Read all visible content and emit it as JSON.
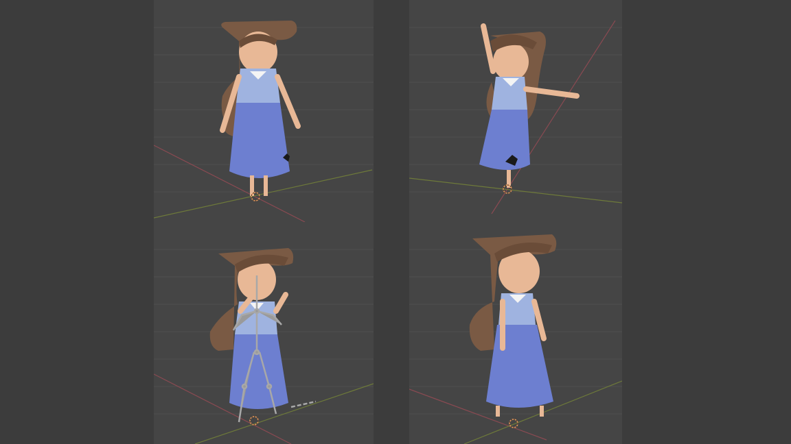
{
  "viewports": [
    {
      "id": "front-rest",
      "pose": "a-pose",
      "armature_visible": false
    },
    {
      "id": "dance-pose",
      "pose": "raised-arm",
      "armature_visible": false
    },
    {
      "id": "armature-view",
      "pose": "hands-up",
      "armature_visible": true
    },
    {
      "id": "three-quarter",
      "pose": "hands-on-hips",
      "armature_visible": false
    }
  ],
  "colors": {
    "background": "#3c3c3c",
    "viewport_bg": "#454545",
    "grid": "#4e4e4e",
    "x_axis": "#8a4a52",
    "y_axis": "#6e7a3a",
    "hair": "#7a5a44",
    "skin": "#e8b896",
    "blouse": "#9fb3e0",
    "skirt": "#6d7fd0",
    "collar": "#f4f4f4",
    "poodle": "#1a1a1a",
    "bone": "#a8a8a8",
    "origin_marker": "#f0a060"
  },
  "icons": [
    "origin-cursor-icon",
    "poodle-applique-icon"
  ]
}
